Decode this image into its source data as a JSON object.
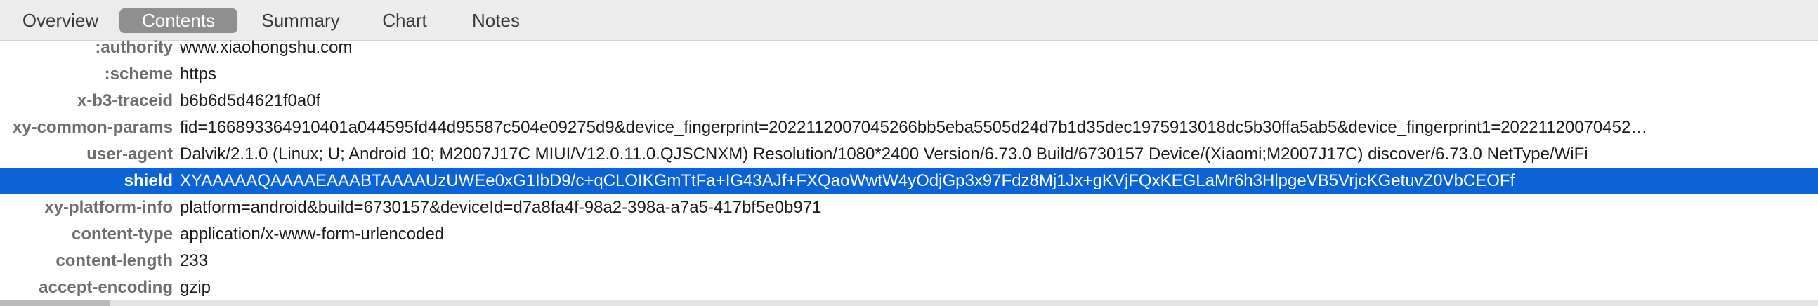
{
  "tabs": [
    {
      "label": "Overview"
    },
    {
      "label": "Contents"
    },
    {
      "label": "Summary"
    },
    {
      "label": "Chart"
    },
    {
      "label": "Notes"
    }
  ],
  "active_tab": "Contents",
  "headers": [
    {
      "key": ":authority",
      "value": "www.xiaohongshu.com"
    },
    {
      "key": ":scheme",
      "value": "https"
    },
    {
      "key": "x-b3-traceid",
      "value": "b6b6d5d4621f0a0f"
    },
    {
      "key": "xy-common-params",
      "value": "fid=166893364910401a044595fd44d95587c504e09275d9&device_fingerprint=2022112007045266bb5eba5505d24d7b1d35dec1975913018dc5b30ffa5ab5&device_fingerprint1=20221120070452…"
    },
    {
      "key": "user-agent",
      "value": "Dalvik/2.1.0 (Linux; U; Android 10; M2007J17C MIUI/V12.0.11.0.QJSCNXM) Resolution/1080*2400 Version/6.73.0 Build/6730157 Device/(Xiaomi;M2007J17C) discover/6.73.0 NetType/WiFi"
    },
    {
      "key": "shield",
      "value": "XYAAAAAQAAAAEAAABTAAAAUzUWEe0xG1IbD9/c+qCLOIKGmTtFa+IG43AJf+FXQaoWwtW4yOdjGp3x97Fdz8Mj1Jx+gKVjFQxKEGLaMr6h3HlpgeVB5VrjcKGetuvZ0VbCEOFf"
    },
    {
      "key": "xy-platform-info",
      "value": "platform=android&build=6730157&deviceId=d7a8fa4f-98a2-398a-a7a5-417bf5e0b971"
    },
    {
      "key": "content-type",
      "value": "application/x-www-form-urlencoded"
    },
    {
      "key": "content-length",
      "value": "233"
    },
    {
      "key": "accept-encoding",
      "value": "gzip"
    }
  ],
  "selected_row": "shield",
  "colors": {
    "selection": "#0b63d6",
    "active_tab": "#8f8f8f",
    "key_text": "#6e6e6e",
    "value_text": "#1d1d1d"
  }
}
